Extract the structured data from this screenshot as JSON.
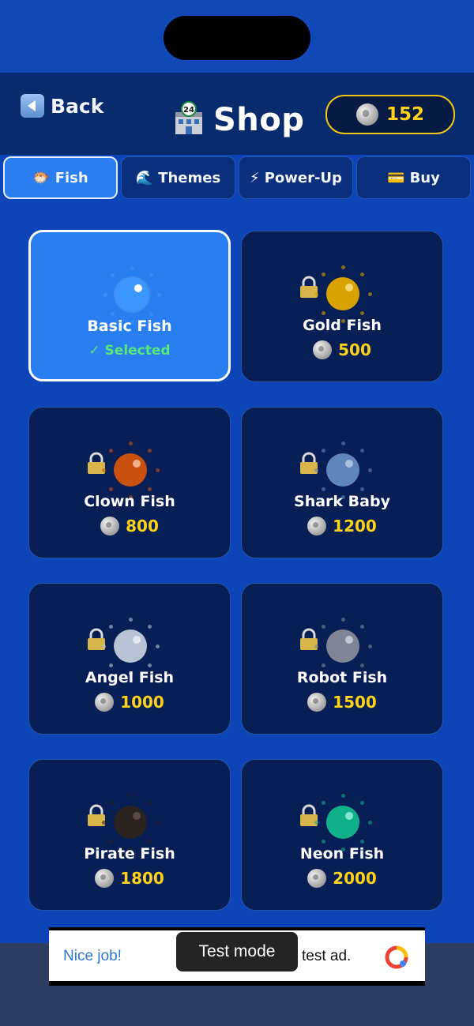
{
  "header": {
    "back_label": "Back",
    "title": "Shop",
    "title_icon": "store-building-24-icon",
    "coins": "152"
  },
  "tabs": [
    {
      "label": "Fish",
      "icon": "🐡",
      "active": true
    },
    {
      "label": "Themes",
      "icon": "🌊",
      "active": false
    },
    {
      "label": "Power-Up",
      "icon": "⚡",
      "active": false
    },
    {
      "label": "Buy",
      "icon": "💳",
      "active": false
    }
  ],
  "fish": [
    {
      "name": "Basic Fish",
      "status": "✓ Selected",
      "selected": true,
      "locked": false,
      "color": "#2f92ff"
    },
    {
      "name": "Gold Fish",
      "price": "500",
      "locked": true,
      "color": "#d8a300"
    },
    {
      "name": "Clown Fish",
      "price": "800",
      "locked": true,
      "color": "#d35a10"
    },
    {
      "name": "Shark Baby",
      "price": "1200",
      "locked": true,
      "color": "#5e86ba"
    },
    {
      "name": "Angel Fish",
      "price": "1000",
      "locked": true,
      "color": "#b9c3d6"
    },
    {
      "name": "Robot Fish",
      "price": "1500",
      "locked": true,
      "color": "#7f8594"
    },
    {
      "name": "Pirate Fish",
      "price": "1800",
      "locked": true,
      "color": "#2a2320"
    },
    {
      "name": "Neon Fish",
      "price": "2000",
      "locked": true,
      "color": "#0fb08a"
    }
  ],
  "ad": {
    "left_text": "Nice job!",
    "toast": "Test mode",
    "right_text": "test ad."
  }
}
